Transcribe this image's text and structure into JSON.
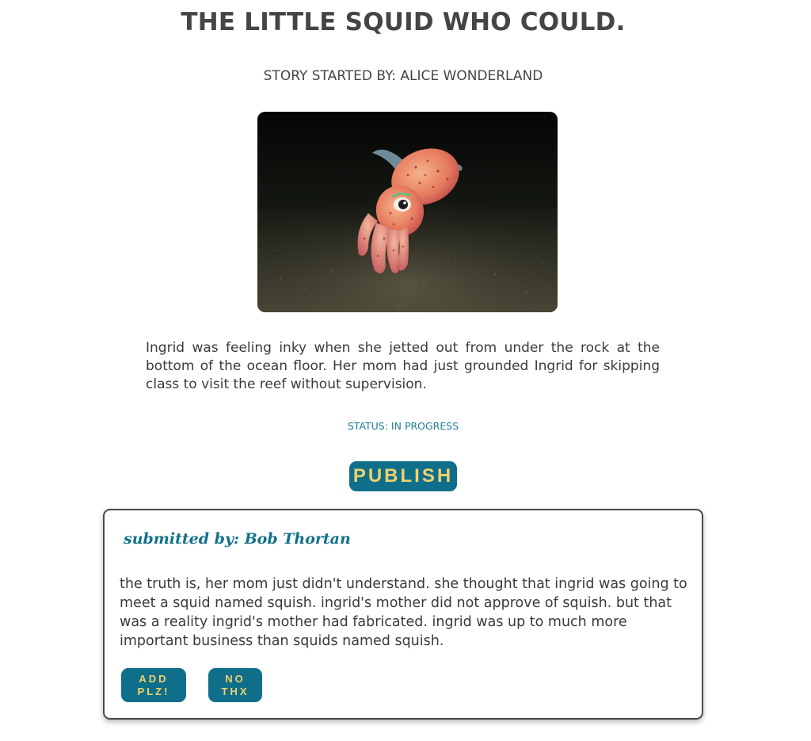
{
  "story": {
    "title": "THE LITTLE SQUID WHO COULD.",
    "byline": "STORY STARTED BY: ALICE WONDERLAND",
    "body": "Ingrid was feeling inky when she jetted out from under the rock at the bottom of the ocean floor. Her mom had just grounded Ingrid for skipping class to visit the reef without supervision.",
    "status": "STATUS: IN PROGRESS",
    "image_subject": "squid-photo"
  },
  "actions": {
    "publish_label": "PUBLISH"
  },
  "submission": {
    "submitted_by": "submitted by: Bob Thortan",
    "text": "the truth is, her mom just didn't understand. she thought that ingrid was going to meet a squid named squish. ingrid's mother did not approve of squish. but that was a reality ingrid's mother had fabricated. ingrid was up to much more important business than squids named squish.",
    "add_label_line1": "ADD",
    "add_label_line2": "PLZ!",
    "reject_label_line1": "NO",
    "reject_label_line2": "THX"
  },
  "colors": {
    "accent": "#0f6f8a",
    "button_text": "#f2d06b",
    "status_text": "#1e7d96",
    "heading_text": "#454545"
  }
}
